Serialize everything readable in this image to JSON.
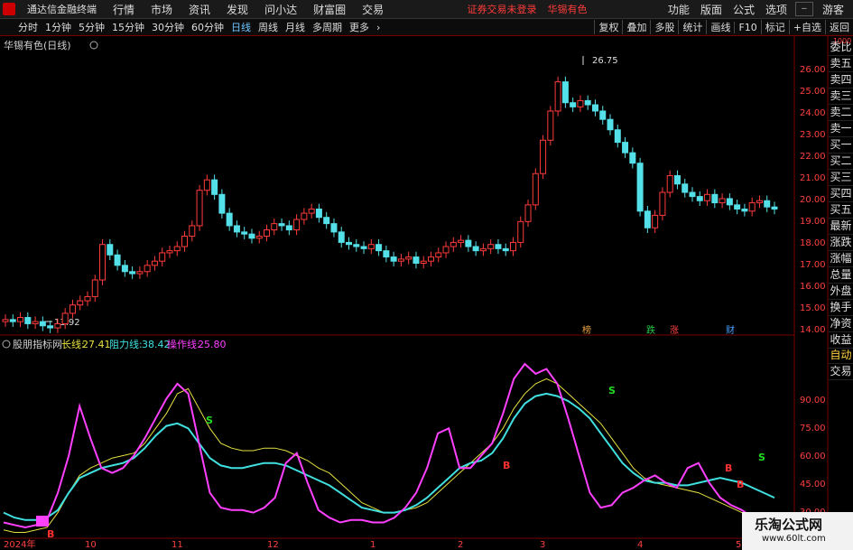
{
  "menubar": {
    "app_title": "通达信金融终端",
    "items": [
      "行情",
      "市场",
      "资讯",
      "发现",
      "问小达",
      "财富圈",
      "交易"
    ],
    "notice": "证券交易未登录",
    "stock": "华锡有色",
    "right_items": [
      "功能",
      "版面",
      "公式",
      "选项"
    ],
    "user": "游客"
  },
  "toolbar": {
    "periods": [
      "分时",
      "1分钟",
      "5分钟",
      "15分钟",
      "30分钟",
      "60分钟",
      "日线",
      "周线",
      "月线",
      "多周期",
      "更多"
    ],
    "active_period": "日线",
    "tools": [
      "复权",
      "叠加",
      "多股",
      "统计",
      "画线",
      "F10",
      "标记",
      "+自选",
      "返回"
    ]
  },
  "main_chart": {
    "title": "华锡有色(日线)",
    "high_label": "26.75",
    "low_label": "13.92",
    "y_ticks": [
      "26.00",
      "25.00",
      "24.00",
      "23.00",
      "22.00",
      "21.00",
      "20.00",
      "19.00",
      "18.00",
      "17.00",
      "16.00",
      "15.00",
      "14.00"
    ],
    "markers": [
      {
        "label": "榜",
        "color": "#e8a040"
      },
      {
        "label": "跌",
        "color": "#22cc44"
      },
      {
        "label": "涨",
        "color": "#ff4040"
      },
      {
        "label": "财",
        "color": "#4aa0ff"
      }
    ]
  },
  "indicator": {
    "name": "股朋指标网",
    "lines": [
      {
        "name": "长线:",
        "value": "27.41",
        "color": "#e6e040"
      },
      {
        "name": "阻力线:",
        "value": "38.42",
        "color": "#40e0e0"
      },
      {
        "name": "操作线:",
        "value": "25.80",
        "color": "#ff40ff"
      }
    ],
    "y_ticks": [
      "90.00",
      "75.00",
      "60.00",
      "45.00",
      "30.00"
    ],
    "signals": [
      "S",
      "S",
      "B",
      "B",
      "S",
      "B",
      "B"
    ]
  },
  "xaxis": {
    "labels": [
      "2024年",
      "10",
      "11",
      "12",
      "1",
      "2",
      "3",
      "4",
      "5"
    ]
  },
  "sidebar": {
    "top_label": "1000",
    "quote_items": [
      "委比",
      "卖五",
      "卖四",
      "卖三",
      "卖二",
      "卖一",
      "买一",
      "买二",
      "买三",
      "买四",
      "买五",
      "最新",
      "涨跌",
      "涨幅",
      "总量",
      "外盘",
      "换手",
      "净资",
      "收益"
    ],
    "bottom_items": [
      "自动",
      "交易"
    ]
  },
  "watermark": {
    "title": "乐淘公式网",
    "url": "www.60lt.com"
  },
  "chart_data": [
    {
      "type": "candlestick",
      "title": "华锡有色(日线)",
      "ylim": [
        13.6,
        27.2
      ],
      "x": [
        "2024年",
        "10",
        "11",
        "12",
        "1",
        "2",
        "3",
        "4",
        "5"
      ],
      "close": [
        14.3,
        14.2,
        14.4,
        14.1,
        14.2,
        14.0,
        13.9,
        14.1,
        14.6,
        15.0,
        15.2,
        15.4,
        16.2,
        17.9,
        17.4,
        16.9,
        16.6,
        16.5,
        16.6,
        16.9,
        17.1,
        17.5,
        17.6,
        17.8,
        18.3,
        18.8,
        20.5,
        21.0,
        20.3,
        19.4,
        18.8,
        18.5,
        18.4,
        18.2,
        18.3,
        18.6,
        18.9,
        18.8,
        18.6,
        19.1,
        19.4,
        19.6,
        19.2,
        18.9,
        18.5,
        18.0,
        17.9,
        17.8,
        17.7,
        17.9,
        17.6,
        17.3,
        17.1,
        17.2,
        17.3,
        17.0,
        17.1,
        17.3,
        17.5,
        17.8,
        18.0,
        18.1,
        17.8,
        17.6,
        17.7,
        17.9,
        17.7,
        17.6,
        18.0,
        19.0,
        19.8,
        21.3,
        22.9,
        24.3,
        25.7,
        24.7,
        24.5,
        24.8,
        24.6,
        24.3,
        23.9,
        23.4,
        22.8,
        22.3,
        21.8,
        19.5,
        18.7,
        19.3,
        20.4,
        21.2,
        20.8,
        20.4,
        20.2,
        20.0,
        20.3,
        19.9,
        20.1,
        19.8,
        19.6,
        19.5,
        19.9,
        20.0,
        19.7,
        19.6
      ]
    },
    {
      "type": "line",
      "title": "股朋指标网",
      "ylim": [
        22,
        96
      ],
      "x": [
        "2024年",
        "10",
        "11",
        "12",
        "1",
        "2",
        "3",
        "4",
        "5"
      ],
      "series": [
        {
          "name": "长线",
          "values": [
            25,
            24,
            24,
            25,
            26,
            32,
            40,
            47,
            50,
            52,
            54,
            55,
            56,
            60,
            66,
            72,
            80,
            82,
            74,
            66,
            60,
            58,
            57,
            57,
            58,
            58,
            57,
            55,
            53,
            50,
            48,
            44,
            40,
            36,
            34,
            32,
            32,
            33,
            34,
            36,
            40,
            44,
            48,
            52,
            56,
            60,
            66,
            74,
            80,
            84,
            86,
            84,
            80,
            76,
            72,
            68,
            62,
            56,
            50,
            46,
            44,
            43,
            42,
            41,
            40,
            38,
            36,
            34,
            32,
            30,
            28,
            27
          ]
        },
        {
          "name": "阻力线",
          "values": [
            32,
            30,
            29,
            29,
            30,
            33,
            40,
            46,
            48,
            50,
            51,
            52,
            54,
            58,
            63,
            67,
            68,
            66,
            60,
            54,
            51,
            50,
            50,
            51,
            52,
            52,
            51,
            49,
            47,
            45,
            43,
            40,
            37,
            34,
            33,
            32,
            32,
            33,
            35,
            38,
            42,
            46,
            50,
            52,
            53,
            56,
            62,
            70,
            76,
            79,
            80,
            79,
            77,
            74,
            70,
            64,
            58,
            52,
            48,
            45,
            44,
            44,
            43,
            43,
            44,
            45,
            46,
            45,
            44,
            42,
            40,
            38
          ]
        },
        {
          "name": "操作线",
          "values": [
            28,
            27,
            26,
            27,
            29,
            40,
            55,
            75,
            62,
            50,
            48,
            50,
            55,
            62,
            70,
            78,
            84,
            80,
            60,
            40,
            34,
            33,
            33,
            32,
            34,
            38,
            52,
            56,
            44,
            33,
            30,
            28,
            29,
            29,
            28,
            28,
            30,
            34,
            40,
            50,
            64,
            66,
            50,
            50,
            55,
            60,
            72,
            86,
            92,
            88,
            90,
            84,
            70,
            55,
            40,
            34,
            35,
            40,
            42,
            45,
            47,
            44,
            42,
            50,
            52,
            44,
            38,
            35,
            33,
            30,
            26,
            25
          ]
        }
      ]
    }
  ]
}
